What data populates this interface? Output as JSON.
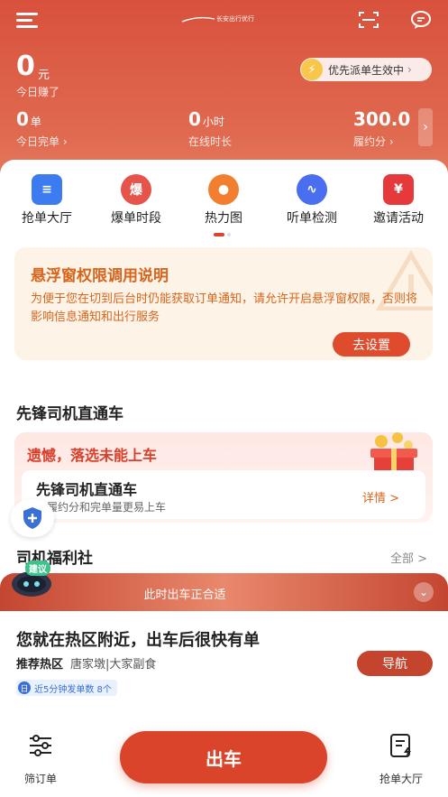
{
  "header": {
    "logo_text": "长安出行优行",
    "earnings": {
      "value": "0",
      "unit": "元",
      "label": "今日赚了"
    },
    "priority_pill": "优先派单生效中",
    "stats": [
      {
        "value": "0",
        "unit": "单",
        "label": "今日完单"
      },
      {
        "value": "0",
        "unit": "小时",
        "label": "在线时长"
      },
      {
        "value": "300.0",
        "unit": "",
        "label": "履约分"
      }
    ]
  },
  "nav": [
    {
      "label": "抢单大厅",
      "icon": "grab-order-icon",
      "color": "#3c7cf0"
    },
    {
      "label": "爆单时段",
      "icon": "surge-time-icon",
      "color": "#e5534b"
    },
    {
      "label": "热力图",
      "icon": "heatmap-icon",
      "color": "#f27f2f"
    },
    {
      "label": "听单检测",
      "icon": "listen-check-icon",
      "color": "#4a6ef0"
    },
    {
      "label": "邀请活动",
      "icon": "invite-icon",
      "color": "#e5393b"
    }
  ],
  "notice": {
    "title": "悬浮窗权限调用说明",
    "body": "为便于您在切到后台时仍能获取订单通知，请允许开启悬浮窗权限，否则将影响信息通知和出行服务",
    "button": "去设置"
  },
  "pioneer": {
    "section_title": "先锋司机直通车",
    "banner": "遗憾，落选未能上车",
    "inner_title": "先锋司机直通车",
    "inner_sub": "高履约分和完单量更易上车",
    "link": "详情 >"
  },
  "welfare": {
    "title": "司机福利社",
    "more": "全部 >"
  },
  "sheet": {
    "robot_tag": "建议",
    "header": "此时出车正合适",
    "title": "您就在热区附近，出车后很快有单",
    "hot_label": "推荐热区",
    "hot_areas": "唐家墩|大家副食",
    "nav_button": "导航",
    "stat_tag": "近5分钟发单数 8个"
  },
  "bottom": {
    "filter": "筛订单",
    "go": "出车",
    "grab": "抢单大厅"
  },
  "colors": {
    "brand": "#d9442a",
    "notice_text": "#d8651d"
  }
}
